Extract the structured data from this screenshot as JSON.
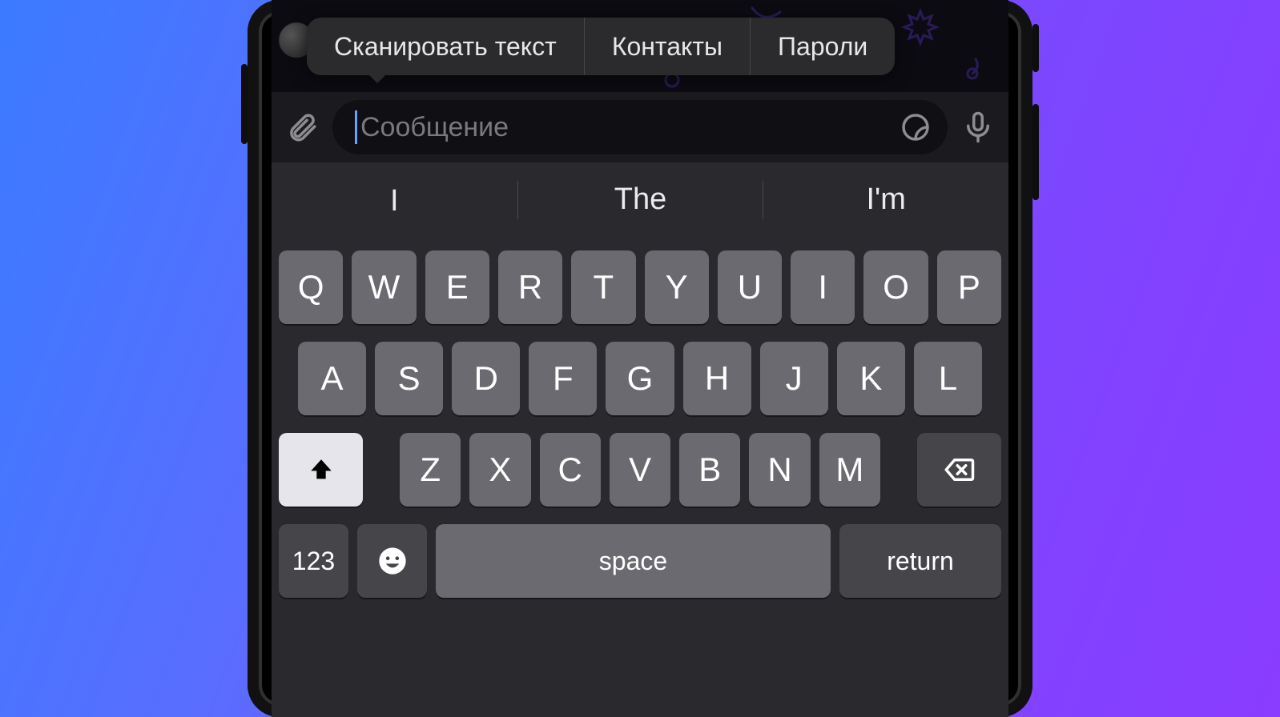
{
  "popover": {
    "scan_text": "Сканировать текст",
    "contacts": "Контакты",
    "passwords": "Пароли"
  },
  "input": {
    "placeholder": "Сообщение"
  },
  "suggestions": [
    "I",
    "The",
    "I'm"
  ],
  "keyboard": {
    "row1": [
      "Q",
      "W",
      "E",
      "R",
      "T",
      "Y",
      "U",
      "I",
      "O",
      "P"
    ],
    "row2": [
      "A",
      "S",
      "D",
      "F",
      "G",
      "H",
      "J",
      "K",
      "L"
    ],
    "row3": [
      "Z",
      "X",
      "C",
      "V",
      "B",
      "N",
      "M"
    ],
    "numeric": "123",
    "space": "space",
    "return": "return"
  }
}
